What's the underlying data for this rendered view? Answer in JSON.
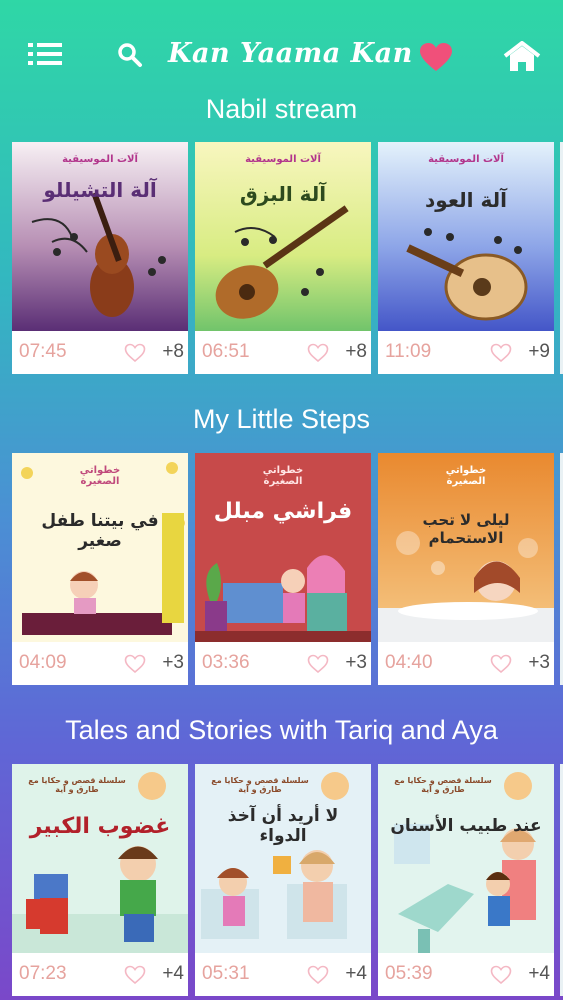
{
  "app": {
    "logo": "Kan Yaama Kan",
    "icons": {
      "menu": "menu-icon",
      "search": "search-icon",
      "favorites": "heart-icon",
      "home": "home-icon"
    },
    "colors": {
      "accent_heart": "#f0507a",
      "duration": "#e6a39e"
    }
  },
  "sections": [
    {
      "title": "Nabil stream",
      "cards": [
        {
          "title": "آلة التشيللو",
          "brand": "آلات الموسيقية",
          "duration": "07:45",
          "likes": "+8"
        },
        {
          "title": "آلة البزق",
          "brand": "آلات الموسيقية",
          "duration": "06:51",
          "likes": "+8"
        },
        {
          "title": "آلة العود",
          "brand": "آلات الموسيقية",
          "duration": "11:09",
          "likes": "+9"
        }
      ]
    },
    {
      "title": "My Little Steps",
      "cards": [
        {
          "title": "في بيتنا طفل صغير",
          "brand": "خطواتي الصغيرة",
          "duration": "04:09",
          "likes": "+3"
        },
        {
          "title": "فراشي مبلل",
          "brand": "خطواتي الصغيرة",
          "duration": "03:36",
          "likes": "+3"
        },
        {
          "title": "ليلى لا تحب الاستحمام",
          "brand": "خطواتي الصغيرة",
          "duration": "04:40",
          "likes": "+3"
        }
      ]
    },
    {
      "title": "Tales and Stories with Tariq and Aya",
      "cards": [
        {
          "title": "غضوب الكبير",
          "brand": "سلسلة قصص و حكايا مع طارق و آية",
          "duration": "07:23",
          "likes": "+4"
        },
        {
          "title": "لا أريد أن آخذ الدواء",
          "brand": "سلسلة قصص و حكايا مع طارق و آية",
          "duration": "05:31",
          "likes": "+4"
        },
        {
          "title": "عند طبيب الأسنان",
          "brand": "سلسلة قصص و حكايا مع طارق و آية",
          "duration": "05:39",
          "likes": "+4"
        }
      ]
    }
  ]
}
